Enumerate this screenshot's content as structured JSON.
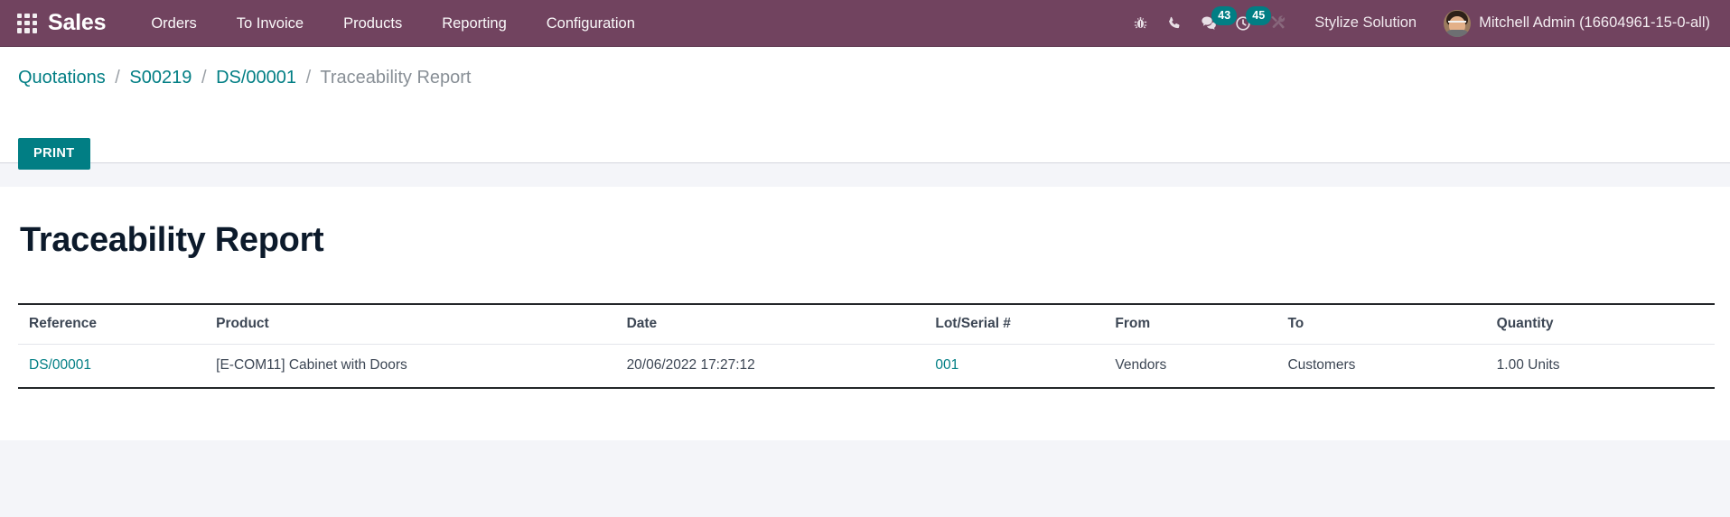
{
  "navbar": {
    "apps_icon": "apps-grid-icon",
    "brand": "Sales",
    "menu": [
      {
        "label": "Orders"
      },
      {
        "label": "To Invoice"
      },
      {
        "label": "Products"
      },
      {
        "label": "Reporting"
      },
      {
        "label": "Configuration"
      }
    ],
    "icons": [
      {
        "name": "bug-icon",
        "badge": null
      },
      {
        "name": "phone-icon",
        "badge": null
      },
      {
        "name": "messages-icon",
        "badge": "43"
      },
      {
        "name": "activity-clock-icon",
        "badge": "45"
      },
      {
        "name": "tools-icon",
        "badge": null
      }
    ],
    "company": "Stylize Solution",
    "user": "Mitchell Admin (16604961-15-0-all)",
    "avatar_name": "user-avatar",
    "background_color": "#71435F",
    "badge_color": "#017E84"
  },
  "control_panel": {
    "breadcrumb": [
      {
        "label": "Quotations",
        "current": false
      },
      {
        "label": "S00219",
        "current": false
      },
      {
        "label": "DS/00001",
        "current": false
      },
      {
        "label": "Traceability Report",
        "current": true
      }
    ],
    "separator": "/",
    "print_label": "PRINT",
    "print_color": "#017E84"
  },
  "report": {
    "title": "Traceability Report",
    "columns": [
      "Reference",
      "Product",
      "Date",
      "Lot/Serial #",
      "From",
      "To",
      "Quantity"
    ],
    "rows": [
      {
        "reference": "DS/00001",
        "product": "[E-COM11] Cabinet with Doors",
        "date": "20/06/2022 17:27:12",
        "lot_serial": "001",
        "from": "Vendors",
        "to": "Customers",
        "quantity": "1.00 Units"
      }
    ],
    "link_color": "#017E84"
  }
}
